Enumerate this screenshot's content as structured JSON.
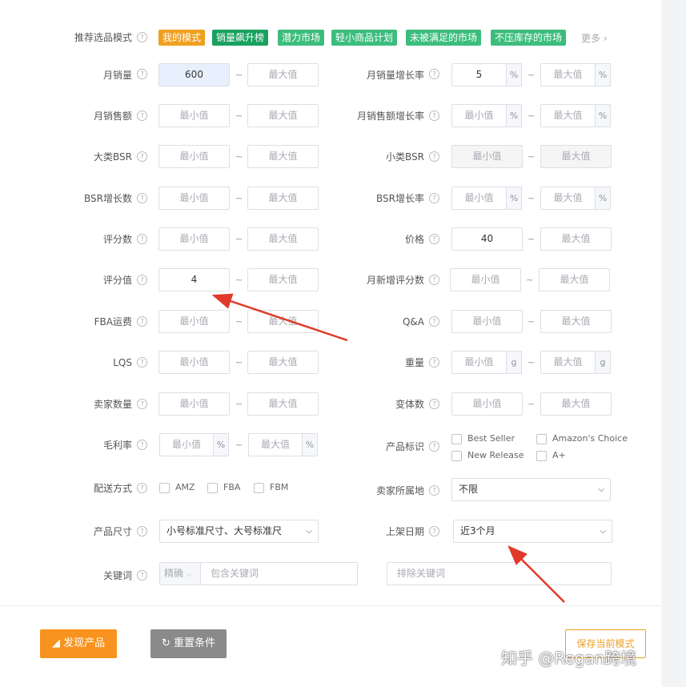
{
  "colors": {
    "accent_orange": "#f0a020",
    "tag_green": "#3dbd7d",
    "arrow_red": "#e03a2a"
  },
  "recommend": {
    "label": "推荐选品模式",
    "tags": [
      {
        "text": "我的模式",
        "color": "#f0a020"
      },
      {
        "text": "销量飙升榜",
        "color": "#19a15f"
      },
      {
        "text": "潜力市场",
        "color": "#3dbd7d"
      },
      {
        "text": "轻小商品计划",
        "color": "#3dbd7d"
      },
      {
        "text": "未被满足的市场",
        "color": "#3dbd7d"
      },
      {
        "text": "不压库存的市场",
        "color": "#3dbd7d"
      }
    ],
    "more": "更多"
  },
  "placeholders": {
    "min": "最小值",
    "max": "最大值"
  },
  "left": {
    "monthly_sales": {
      "label": "月销量",
      "min": "600"
    },
    "monthly_revenue": {
      "label": "月销售额"
    },
    "main_bsr": {
      "label": "大类BSR"
    },
    "bsr_growth_count": {
      "label": "BSR增长数"
    },
    "rating_count": {
      "label": "评分数"
    },
    "rating_value": {
      "label": "评分值",
      "min": "4"
    },
    "fba_fee": {
      "label": "FBA运费"
    },
    "lqs": {
      "label": "LQS"
    },
    "seller_count": {
      "label": "卖家数量"
    },
    "gross_margin": {
      "label": "毛利率",
      "unit": "%"
    },
    "delivery": {
      "label": "配送方式",
      "options": [
        "AMZ",
        "FBA",
        "FBM"
      ]
    },
    "size": {
      "label": "产品尺寸",
      "value": "小号标准尺寸、大号标准尺"
    },
    "keyword": {
      "label": "关键词",
      "mode": "精确",
      "placeholder": "包含关键词"
    }
  },
  "right": {
    "monthly_sales_growth": {
      "label": "月销量增长率",
      "min": "5",
      "unit": "%"
    },
    "monthly_revenue_growth": {
      "label": "月销售额增长率",
      "unit": "%"
    },
    "sub_bsr": {
      "label": "小类BSR"
    },
    "bsr_growth_rate": {
      "label": "BSR增长率",
      "unit": "%"
    },
    "price": {
      "label": "价格",
      "min": "40"
    },
    "monthly_new_ratings": {
      "label": "月新增评分数"
    },
    "qa": {
      "label": "Q&A"
    },
    "weight": {
      "label": "重量",
      "unit": "g"
    },
    "variants": {
      "label": "变体数"
    },
    "badges": {
      "label": "产品标识",
      "options": [
        "Best Seller",
        "Amazon's Choice",
        "New Release",
        "A+"
      ]
    },
    "seller_location": {
      "label": "卖家所属地",
      "value": "不限"
    },
    "listing_date": {
      "label": "上架日期",
      "value": "近3个月"
    },
    "exclude_keyword": {
      "placeholder": "排除关键词"
    }
  },
  "buttons": {
    "discover": "发现产品",
    "reset": "重置条件",
    "save_mode": "保存当前模式"
  },
  "watermark": "知乎 @Regan跨境"
}
